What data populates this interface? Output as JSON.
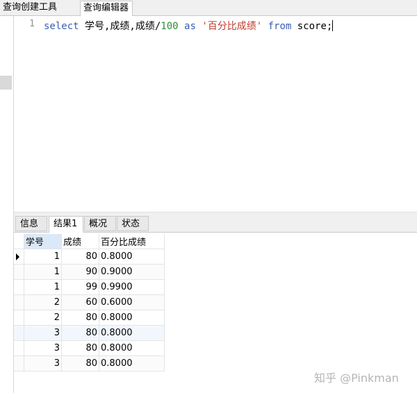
{
  "top_tabs": [
    "查询创建工具",
    "查询编辑器"
  ],
  "editor": {
    "line_number": "1",
    "code": {
      "kw_select": "select",
      "fields": " 学号,成绩,成绩/",
      "num": "100",
      "kw_as": " as ",
      "alias": "'百分比成绩'",
      "kw_from": " from",
      "table": " score;"
    }
  },
  "result_tabs": [
    "信息",
    "结果1",
    "概况",
    "状态"
  ],
  "results": {
    "columns": [
      "学号",
      "成绩",
      "百分比成绩"
    ],
    "rows": [
      [
        "1",
        "80",
        "0.8000"
      ],
      [
        "1",
        "90",
        "0.9000"
      ],
      [
        "1",
        "99",
        "0.9900"
      ],
      [
        "2",
        "60",
        "0.6000"
      ],
      [
        "2",
        "80",
        "0.8000"
      ],
      [
        "3",
        "80",
        "0.8000"
      ],
      [
        "3",
        "80",
        "0.8000"
      ],
      [
        "3",
        "80",
        "0.8000"
      ]
    ]
  },
  "watermark": "知乎 @Pinkman",
  "colors": {
    "keyword": "#3a5eb8",
    "number": "#2e8b3a",
    "string": "#c0392b"
  }
}
